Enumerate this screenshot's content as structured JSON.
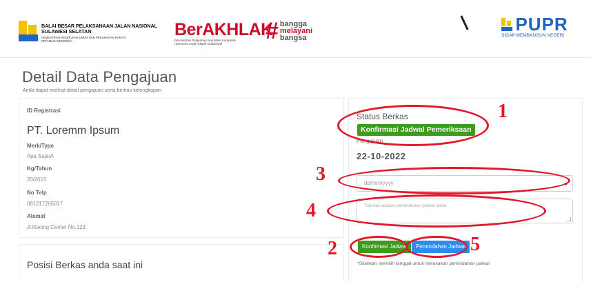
{
  "header": {
    "org_line1": "BALAI BESAR PELAKSANAAN JALAN NASIONAL",
    "org_line2": "SULAWESI SELATAN",
    "org_line3": "KEMENTRIAN PEKERJAAN UMUM DAN PERUMAHAN RAKYAT",
    "org_line4": "REPUBLIK INDONESIA",
    "berakhlak_title": "BerAKHLAK",
    "berakhlak_sub1": "Berorientasi Pelayanan Akuntabel Kompeten",
    "berakhlak_sub2": "Harmonis Loyal Adaptif Kolaboratif",
    "bangga_1": "bangga",
    "bangga_2": "melayani",
    "bangga_3": "bangsa",
    "pupr_text": "PUPR",
    "pupr_sub": "SIGAP MEMBANGUN NEGERI"
  },
  "page": {
    "title": "Detail Data Pengajuan",
    "subtitle": "Anda dapat melihat detail pengajuan serta berkas kelengkapan"
  },
  "detail": {
    "id_label": "ID Registrasi",
    "company": "PT. Loremm Ipsum",
    "merk_label": "Merk/Type",
    "merk_value": "Apa Saja/A",
    "kg_label": "Kg/Tahun",
    "kg_value": "20/2015",
    "telp_label": "No Telp",
    "telp_value": "081217265017",
    "alamat_label": "Alamat",
    "alamat_value": "Jl.Racing Center No.123",
    "posisi_title": "Posisi Berkas anda saat ini"
  },
  "status": {
    "label": "Status Berkas",
    "badge": "Konfirmasi Jadwal Pemeriksaan",
    "pengajuan_label": "Pengajuan",
    "date": "22-10-2022",
    "date_placeholder": "dd/mm/yyyy",
    "reason_placeholder": "Tuliskan alasan pemindahan jadwal anda",
    "btn_konfirmasi": "Konfirmasi Jadwal",
    "btn_pemindahan": "Pemindahan Jadwal",
    "note": "*Silahkan memilih tanggal untuk melukakan pemindahan jadwal"
  },
  "annotations": {
    "n1": "1",
    "n2": "2",
    "n3": "3",
    "n4": "4",
    "n5": "5"
  },
  "colors": {
    "accent_green": "#3d9a1e",
    "accent_blue": "#2a8cf0",
    "annotation_red": "#e3162a",
    "brand_red": "#c8102e",
    "pupr_blue": "#1f66c2"
  }
}
